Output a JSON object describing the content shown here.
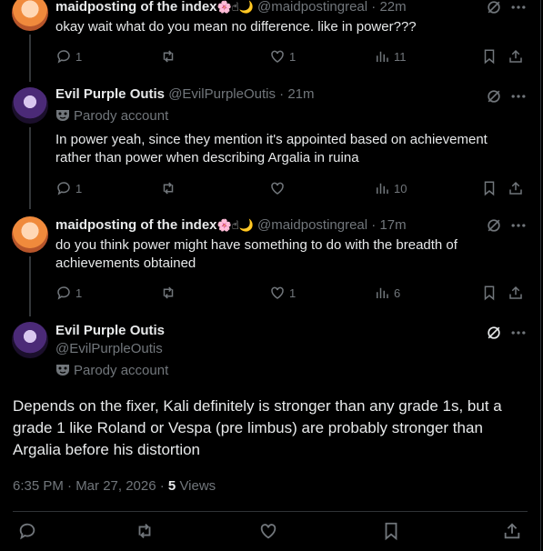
{
  "posts": [
    {
      "name": "maidposting of the index",
      "emojis": "🌸☝🌙",
      "handle": "@maidpostingreal",
      "time": "· 22m",
      "text": "okay wait what do you mean no difference. like in power???",
      "replies": "1",
      "reposts": "",
      "likes": "1",
      "views": "11"
    },
    {
      "name": "Evil Purple Outis",
      "handle": "@EvilPurpleOutis",
      "time": "· 21m",
      "badge": "Parody account",
      "text": "In power yeah, since they mention it's appointed based on achievement rather than power when describing Argalia in ruina",
      "replies": "1",
      "reposts": "",
      "likes": "",
      "views": "10"
    },
    {
      "name": "maidposting of the index",
      "emojis": "🌸☝🌙",
      "handle": "@maidpostingreal",
      "time": "· 17m",
      "text": "do you think power might have something to do with the breadth of achievements obtained",
      "replies": "1",
      "reposts": "",
      "likes": "1",
      "views": "6"
    }
  ],
  "main_post": {
    "name": "Evil Purple Outis",
    "handle": "@EvilPurpleOutis",
    "badge": "Parody account",
    "text": "Depends on the fixer, Kali definitely is stronger than any grade 1s, but a grade 1 like Roland or Vespa (pre limbus) are probably stronger than Argalia before his distortion",
    "timestamp": "6:35 PM · Mar 27, 2026 ·",
    "views_count": "5",
    "views_label": "Views"
  },
  "icons": [
    "grok-icon",
    "more-icon",
    "reply-icon",
    "repost-icon",
    "like-icon",
    "views-icon",
    "bookmark-icon",
    "share-icon",
    "mask-icon"
  ],
  "colors": {
    "background": "#000000",
    "text": "#e7e9ea",
    "secondary": "#71767b",
    "border": "#2f3336"
  }
}
